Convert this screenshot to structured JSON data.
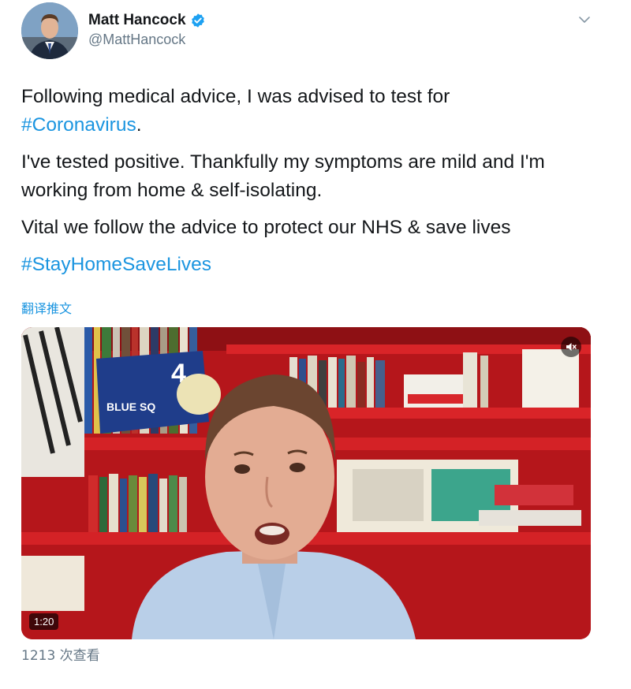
{
  "author": {
    "display_name": "Matt Hancock",
    "handle": "@MattHancock",
    "verified": true,
    "avatar_icon": "profile-photo"
  },
  "tweet": {
    "paragraph1_text": "Following medical advice, I was advised to test for",
    "paragraph1_hashtag": "#Coronavirus",
    "paragraph1_end": ".",
    "paragraph2": "I've tested positive. Thankfully my symptoms are mild and I'm working from home & self-isolating.",
    "paragraph3": "Vital we follow the advice to protect our NHS & save lives",
    "hashtag_line": "#StayHomeSaveLives",
    "translate_label": "翻译推文"
  },
  "video": {
    "duration": "1:20",
    "mute_icon": "speaker-muted-icon",
    "shirt_text": "BLUE SQ",
    "jersey_number": "4"
  },
  "stats": {
    "views": "1213 次查看"
  },
  "colors": {
    "link": "#1b95e0",
    "secondary_text": "#657786",
    "verified": "#1da1f2"
  }
}
